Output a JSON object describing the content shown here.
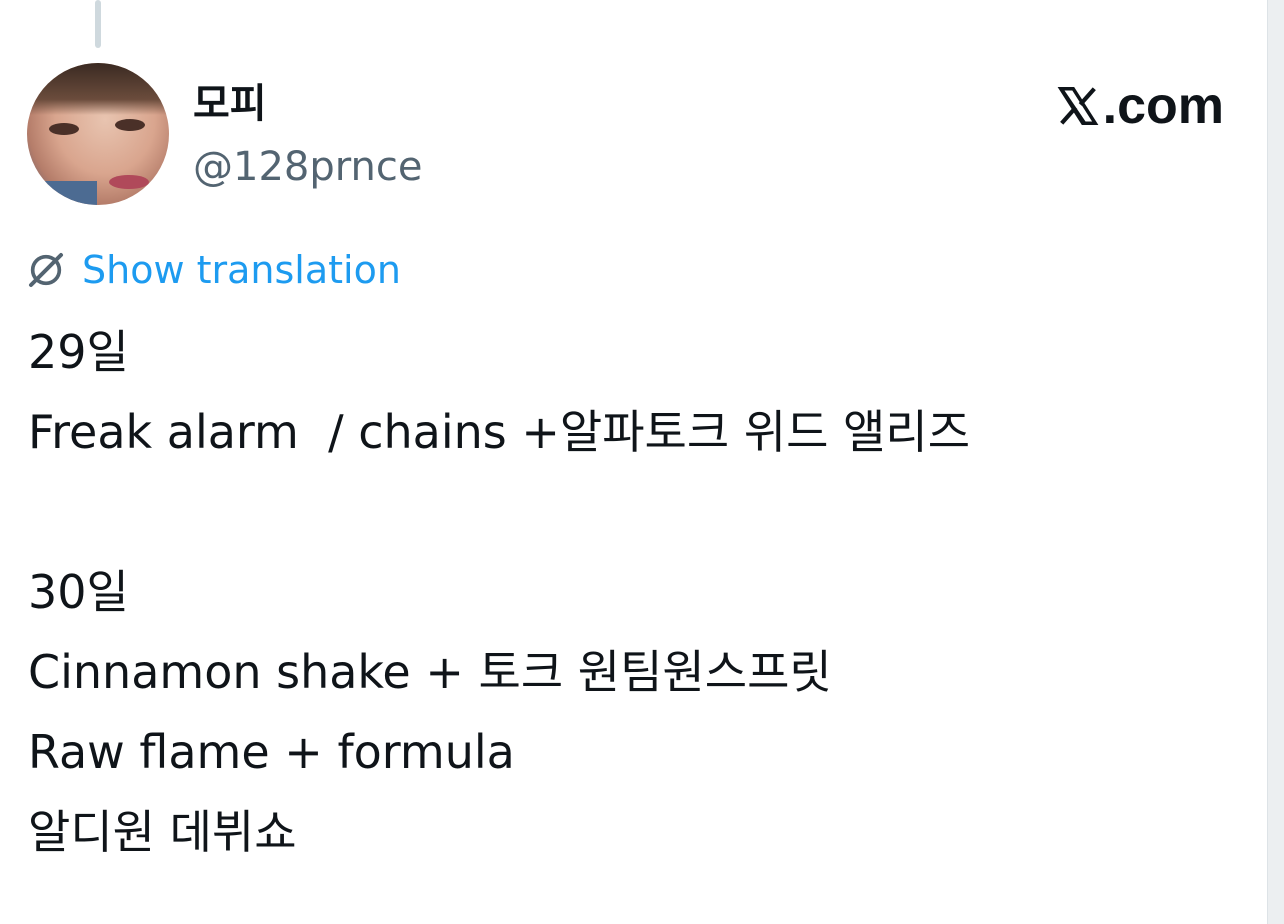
{
  "author": {
    "display_name": "모피",
    "handle": "@128prnce"
  },
  "brand": {
    "label": ".com",
    "icon": "x-logo-icon"
  },
  "translate": {
    "label": "Show translation",
    "icon": "globe-slash-icon",
    "color": "#1d9bf0"
  },
  "tweet": {
    "lines": [
      "29일",
      "Freak alarm  / chains +알파토크 위드 앨리즈",
      "",
      "30일",
      "Cinnamon shake + 토크 원팀원스프릿",
      "Raw flame + formula",
      "알디원 데뷔쇼"
    ]
  },
  "colors": {
    "text_primary": "#0f1419",
    "text_secondary": "#536471",
    "link": "#1d9bf0"
  }
}
